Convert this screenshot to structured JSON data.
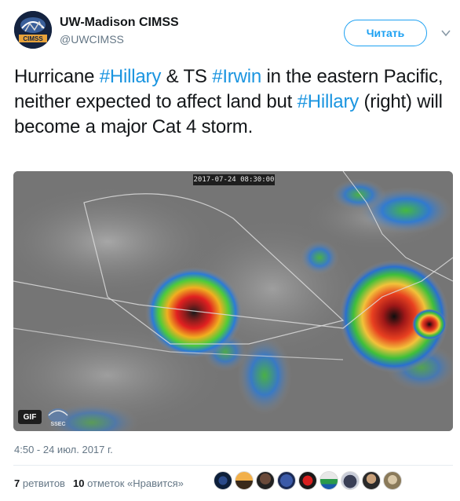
{
  "author": {
    "display_name": "UW-Madison CIMSS",
    "screen_name": "@UWCIMSS",
    "avatar_text": "CIMSS"
  },
  "follow_label": "Читать",
  "tweet": {
    "t1": "Hurricane ",
    "h1": "#Hillary",
    "t2": " & TS ",
    "h2": "#Irwin",
    "t3": " in the eastern Pacific, neither expected to affect land but ",
    "h3": "#Hillary",
    "t4": " (right) will become a major Cat 4 storm."
  },
  "media": {
    "timestamp": "2017-07-24 08:30:00",
    "gif_badge": "GIF",
    "logo_text": "SSEC"
  },
  "post_time": "4:50 - 24 июл. 2017 г.",
  "stats": {
    "retweets_count": "7",
    "retweets_label": "ретвитов",
    "likes_count": "10",
    "likes_label": "отметок «Нравится»"
  },
  "colors": {
    "accent": "#1da1f2",
    "hashtag": "#1b95e0",
    "muted": "#657786"
  }
}
